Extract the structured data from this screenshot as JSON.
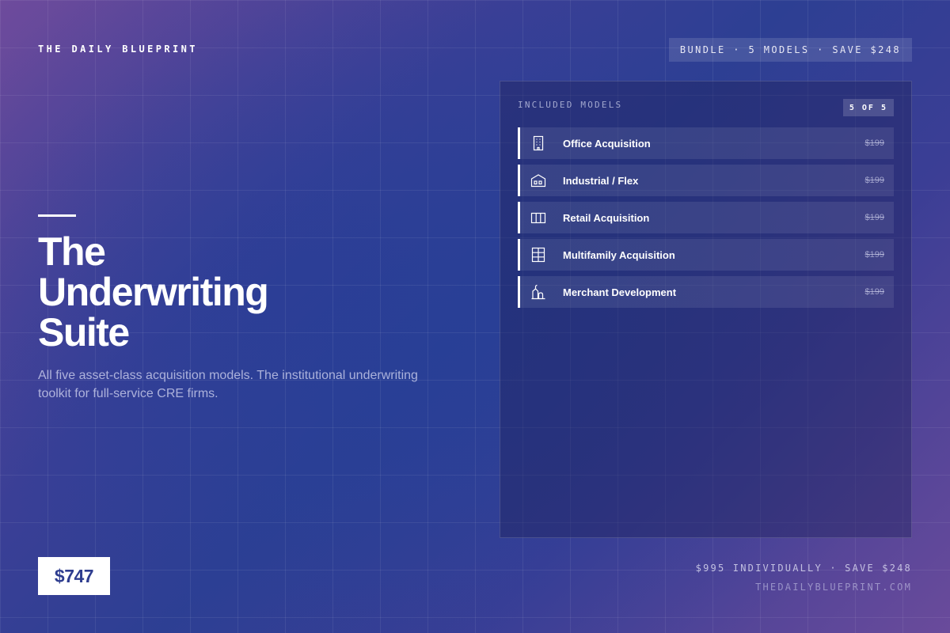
{
  "header": {
    "brand": "THE DAILY BLUEPRINT",
    "bundle_pill": "BUNDLE · 5 MODELS · SAVE $248"
  },
  "hero": {
    "title_lines": [
      "The",
      "Underwriting",
      "Suite"
    ],
    "description": "All five asset-class acquisition models. The institutional underwriting toolkit for full-service CRE firms."
  },
  "panel": {
    "label": "INCLUDED MODELS",
    "count_badge": "5 OF 5",
    "models": [
      {
        "name": "Office Acquisition",
        "price": "$199",
        "icon": "office-building-icon"
      },
      {
        "name": "Industrial / Flex",
        "price": "$199",
        "icon": "warehouse-icon"
      },
      {
        "name": "Retail Acquisition",
        "price": "$199",
        "icon": "storefront-icon"
      },
      {
        "name": "Multifamily Acquisition",
        "price": "$199",
        "icon": "apartment-grid-icon"
      },
      {
        "name": "Merchant Development",
        "price": "$199",
        "icon": "construction-crane-icon"
      }
    ]
  },
  "footer": {
    "price": "$747",
    "note": "$995 INDIVIDUALLY · SAVE $248",
    "url": "THEDAILYBLUEPRINT.COM"
  },
  "colors": {
    "background_mid": "#2d3f93",
    "background_edge": "#6e4b9c",
    "price_text": "#2e3d8f",
    "accent": "#ffffff"
  }
}
